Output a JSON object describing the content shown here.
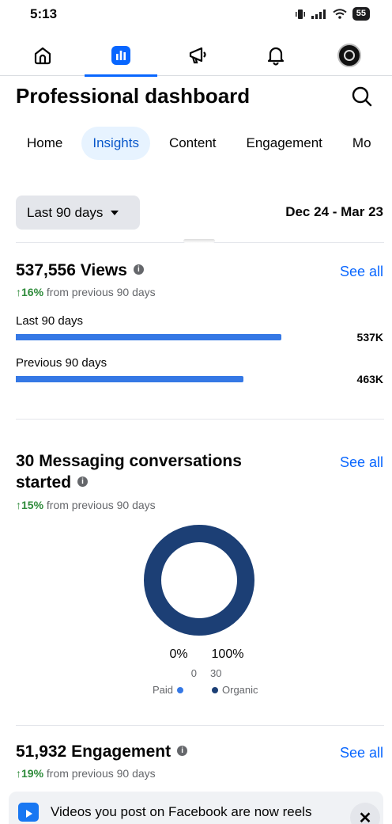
{
  "status_bar": {
    "time": "5:13",
    "battery": "55"
  },
  "nav": {
    "items": [
      {
        "name": "home",
        "icon": "home-icon"
      },
      {
        "name": "insights",
        "icon": "bar-chart-icon",
        "active": true
      },
      {
        "name": "ads",
        "icon": "megaphone-icon"
      },
      {
        "name": "notifications",
        "icon": "bell-icon"
      },
      {
        "name": "profile",
        "icon": "avatar"
      }
    ]
  },
  "header": {
    "title": "Professional dashboard"
  },
  "tabs": [
    {
      "label": "Home"
    },
    {
      "label": "Insights",
      "active": true
    },
    {
      "label": "Content"
    },
    {
      "label": "Engagement"
    },
    {
      "label": "Mo"
    }
  ],
  "filter": {
    "range_label": "Last 90 days",
    "date_range": "Dec 24 - Mar 23"
  },
  "views": {
    "title": "537,556 Views",
    "see_all": "See all",
    "delta_pct": "↑16%",
    "delta_text": " from previous 90 days",
    "bars": [
      {
        "label": "Last 90 days",
        "value": "537K",
        "fraction": 0.84
      },
      {
        "label": "Previous 90 days",
        "value": "463K",
        "fraction": 0.72
      }
    ]
  },
  "messaging": {
    "title_line1": "30 Messaging conversations",
    "title_line2": "started",
    "see_all": "See all",
    "delta_pct": "↑15%",
    "delta_text": " from previous 90 days",
    "paid": {
      "pct": "0%",
      "count": "0",
      "label": "Paid",
      "color": "#3578e5"
    },
    "organic": {
      "pct": "100%",
      "count": "30",
      "label": "Organic",
      "color": "#1c3f75"
    }
  },
  "engagement": {
    "title": "51,932 Engagement",
    "see_all": "See all",
    "delta_pct": "↑19%",
    "delta_text": " from previous 90 days"
  },
  "banner": {
    "text": "Videos you post on Facebook are now reels",
    "close": "✕"
  },
  "colors": {
    "accent": "#0866ff",
    "bar": "#3578e5",
    "organic": "#1c3f75",
    "positive": "#2e8b3a"
  }
}
